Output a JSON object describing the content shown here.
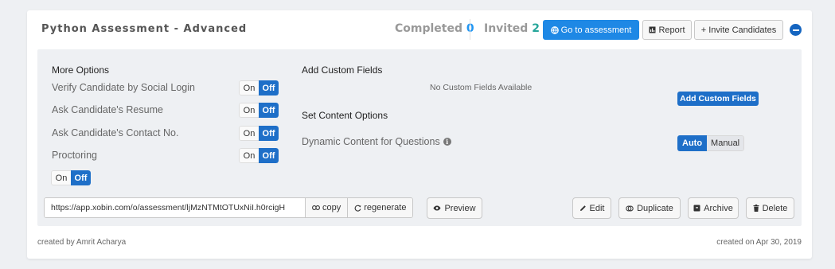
{
  "assessment": {
    "title": "Python Assessment - Advanced",
    "completed_label": "Completed",
    "completed_count": "0",
    "invited_label": "Invited",
    "invited_count": "2"
  },
  "header_actions": {
    "goto_label": "Go to assessment",
    "report_label": "Report",
    "invite_label": "+ Invite Candidates"
  },
  "more_options": {
    "heading": "More Options",
    "items": [
      {
        "label": "Verify Candidate by Social Login",
        "on": "On",
        "off": "Off",
        "value": "Off"
      },
      {
        "label": "Ask Candidate's Resume",
        "on": "On",
        "off": "Off",
        "value": "Off"
      },
      {
        "label": "Ask Candidate's Contact No.",
        "on": "On",
        "off": "Off",
        "value": "Off"
      },
      {
        "label": "Proctoring",
        "on": "On",
        "off": "Off",
        "value": "Off"
      }
    ],
    "extra_toggle": {
      "on": "On",
      "off": "Off",
      "value": "Off"
    }
  },
  "custom_fields": {
    "heading": "Add Custom Fields",
    "empty_text": "No Custom Fields Available",
    "add_label": "Add Custom Fields"
  },
  "content_options": {
    "heading": "Set Content Options",
    "dynamic_label": "Dynamic Content for Questions",
    "auto_label": "Auto",
    "manual_label": "Manual",
    "selected": "Auto"
  },
  "link": {
    "url": "https://app.xobin.com/o/assessment/ljMzNTMtOTUxNiI.h0rcigH",
    "copy_label": "copy",
    "regenerate_label": "regenerate"
  },
  "actions": {
    "preview_label": "Preview",
    "edit_label": "Edit",
    "duplicate_label": "Duplicate",
    "archive_label": "Archive",
    "delete_label": "Delete"
  },
  "footer": {
    "created_by": "created by Amrit Acharya",
    "created_on": "created on Apr 30, 2019"
  },
  "colors": {
    "primary": "#1e88e5",
    "toggle_active": "#1e6fc8",
    "completed_count": "#2196f3",
    "invited_count": "#26a69a"
  },
  "icons": [
    "globe-icon",
    "chart-icon",
    "minus-circle-icon",
    "info-icon",
    "link-icon",
    "refresh-icon",
    "eye-icon",
    "pencil-icon",
    "duplicate-icon",
    "archive-icon",
    "trash-icon"
  ]
}
